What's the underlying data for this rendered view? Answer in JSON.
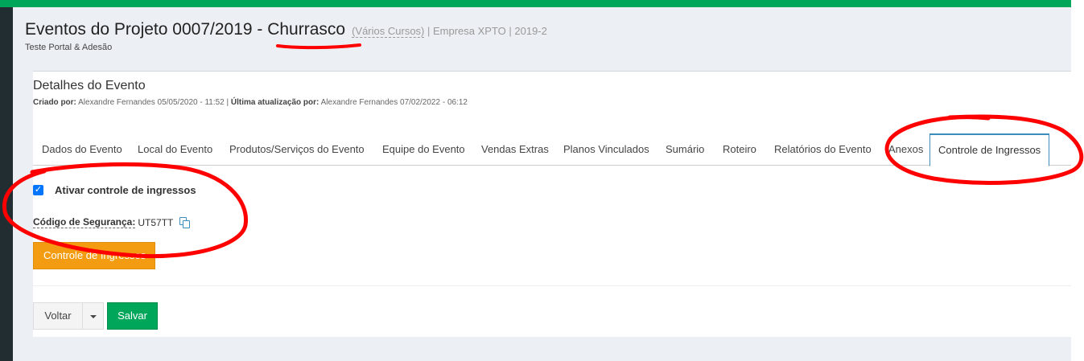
{
  "colors": {
    "topbar": "#00a65a",
    "leftbar": "#222d32",
    "background": "#ecf0f5",
    "annotation": "#ff0000",
    "primary": "#3c8dbc",
    "warning": "#f39c12",
    "success": "#00a65a"
  },
  "header": {
    "title": "Eventos do Projeto 0007/2019 - Churrasco",
    "courses": "(Vários Cursos)",
    "rest": "| Empresa XPTO | 2019-2",
    "subtitle": "Teste Portal & Adesão"
  },
  "box": {
    "title": "Detalhes do Evento",
    "created_label": "Criado por:",
    "created_value": "Alexandre Fernandes 05/05/2020 - 11:52 |",
    "updated_label": "Última atualização por:",
    "updated_value": "Alexandre Fernandes 07/02/2022 - 06:12"
  },
  "tabs": [
    {
      "label": "Dados do Evento"
    },
    {
      "label": "Local do Evento"
    },
    {
      "label": "Produtos/Serviços do Evento"
    },
    {
      "label": "Equipe do Evento"
    },
    {
      "label": "Vendas Extras"
    },
    {
      "label": "Planos Vinculados"
    },
    {
      "label": "Sumário"
    },
    {
      "label": "Roteiro"
    },
    {
      "label": "Relatórios do Evento"
    },
    {
      "label": "Anexos"
    },
    {
      "label": "Controle de Ingressos",
      "active": true
    }
  ],
  "ticket_control": {
    "checkbox_label": "Ativar controle de ingressos",
    "checked": true,
    "code_label": "Código de Segurança:",
    "code_value": "UT57TT",
    "button_label": "Controle de Ingressos"
  },
  "footer": {
    "back_label": "Voltar",
    "save_label": "Salvar"
  },
  "icons": [
    "check-icon",
    "copy-icon",
    "caret-down-icon"
  ]
}
